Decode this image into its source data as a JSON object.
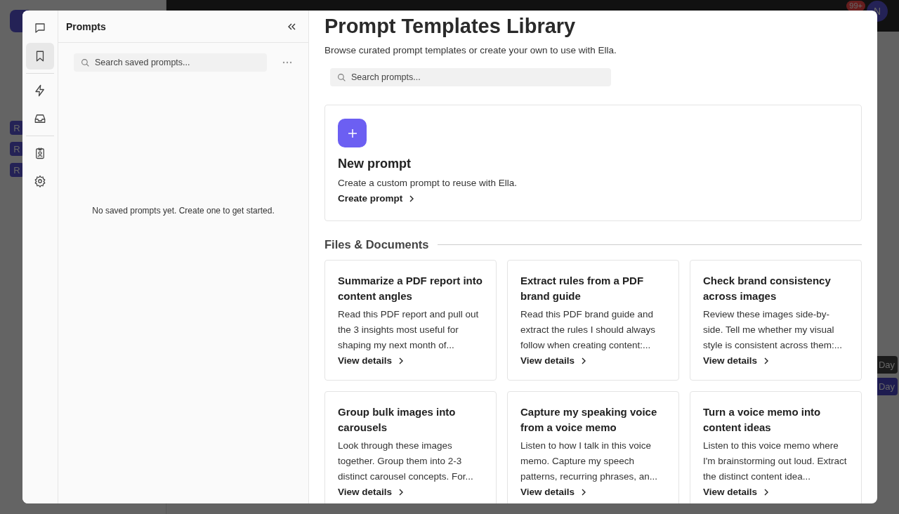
{
  "background": {
    "notifications": "99+",
    "avatar": "N",
    "workspaces": [
      "R",
      "R",
      "R"
    ],
    "day_buttons": [
      {
        "label": "Day",
        "selected": false
      },
      {
        "label": "Day",
        "selected": true
      }
    ]
  },
  "rail": {
    "groups": [
      [
        {
          "kind": "chat",
          "selected": false
        },
        {
          "kind": "bookmark",
          "selected": true
        }
      ],
      [
        {
          "kind": "bolt",
          "selected": false
        },
        {
          "kind": "inbox",
          "selected": false
        }
      ],
      [
        {
          "kind": "badge",
          "selected": false
        },
        {
          "kind": "gear",
          "selected": false
        }
      ]
    ]
  },
  "prompts_panel": {
    "title": "Prompts",
    "search": {
      "placeholder": "Search saved prompts..."
    },
    "empty_message": "No saved prompts yet. Create one to get started."
  },
  "library": {
    "title": "Prompt Templates Library",
    "subtitle": "Browse curated prompt templates or create your own to use with Ella.",
    "search": {
      "placeholder": "Search prompts..."
    },
    "new_prompt": {
      "title": "New prompt",
      "description": "Create a custom prompt to reuse with Ella.",
      "action": "Create prompt"
    },
    "sections": [
      {
        "title": "Files & Documents",
        "cards": [
          {
            "title": "Summarize a PDF report into content angles",
            "description": "Read this PDF report and pull out the 3 insights most useful for shaping my next month of...",
            "action": "View details"
          },
          {
            "title": "Extract rules from a PDF brand guide",
            "description": "Read this PDF brand guide and extract the rules I should always follow when creating content:...",
            "action": "View details"
          },
          {
            "title": "Check brand consistency across images",
            "description": "Review these images side-by-side. Tell me whether my visual style is consistent across them:...",
            "action": "View details"
          },
          {
            "title": "Group bulk images into carousels",
            "description": "Look through these images together. Group them into 2-3 distinct carousel concepts. For...",
            "action": "View details"
          },
          {
            "title": "Capture my speaking voice from a voice memo",
            "description": "Listen to how I talk in this voice memo. Capture my speech patterns, recurring phrases, an...",
            "action": "View details"
          },
          {
            "title": "Turn a voice memo into content ideas",
            "description": "Listen to this voice memo where I'm brainstorming out loud. Extract the distinct content idea...",
            "action": "View details"
          }
        ]
      }
    ]
  }
}
